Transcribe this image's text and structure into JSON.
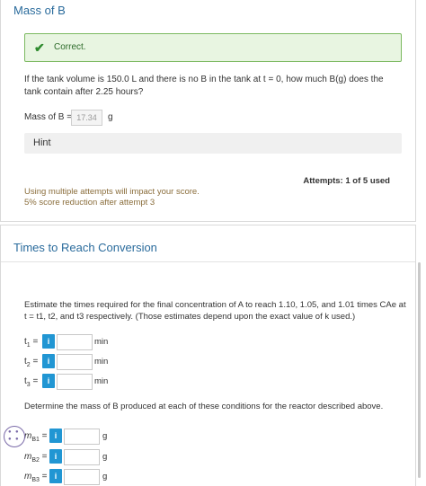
{
  "section1": {
    "title": "Mass of B",
    "feedback": "Correct.",
    "question": "If the tank volume is 150.0 L and there is no B in the tank at t = 0, how much B(g) does the tank contain after 2.25 hours?",
    "answer_label": "Mass of B =",
    "answer_value": "17.34",
    "answer_unit": "g",
    "hint_label": "Hint",
    "attempts": "Attempts: 1 of 5 used",
    "warning_line1": "Using multiple attempts will impact your score.",
    "warning_line2": "5% score reduction after attempt 3"
  },
  "section2": {
    "title": "Times to Reach Conversion",
    "instruction": "Estimate the times required for the final concentration of A to reach 1.10, 1.05, and 1.01 times CAe at t = t1, t2, and t3 respectively. (Those estimates depend upon the exact value of k used.)",
    "time_unit": "min",
    "info_label": "i",
    "mass_question": "Determine the mass of B produced at each of these conditions for the reactor described above.",
    "mass_unit": "g"
  },
  "colors": {
    "accent": "#2196d3",
    "success": "#7cb960",
    "title": "#2a6b9c",
    "warning": "#8a6d3b"
  }
}
